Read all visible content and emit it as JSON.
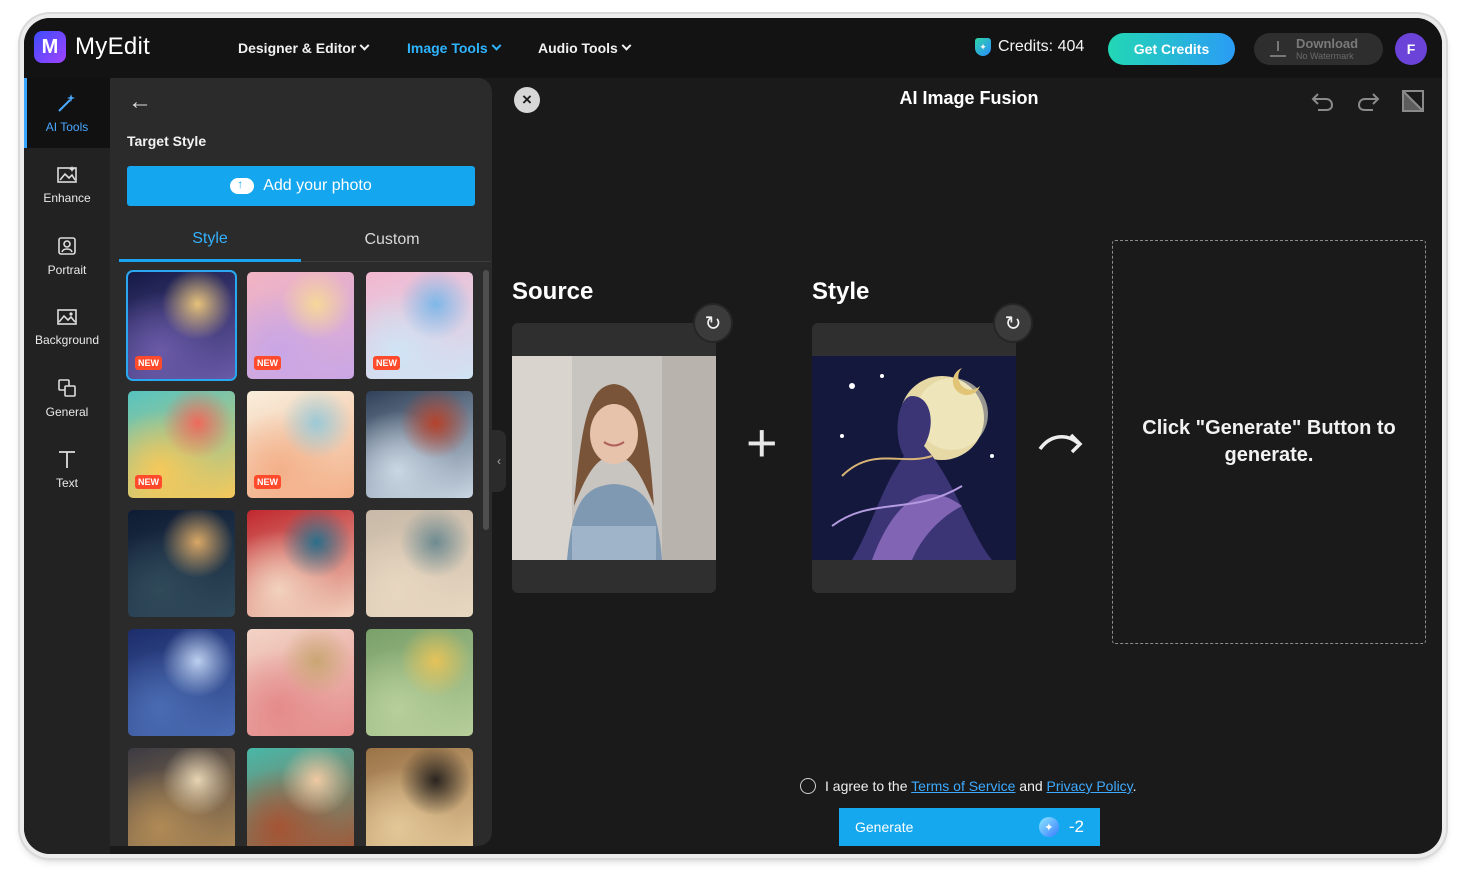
{
  "brand": {
    "name": "MyEdit",
    "logo_letter": "M"
  },
  "nav": [
    {
      "label": "Designer & Editor",
      "active": false
    },
    {
      "label": "Image Tools",
      "active": true
    },
    {
      "label": "Audio Tools",
      "active": false
    }
  ],
  "header": {
    "credits_label": "Credits: 404",
    "get_credits": "Get Credits",
    "download_label": "Download",
    "download_sub": "No Watermark",
    "avatar_letter": "F"
  },
  "rail": [
    {
      "label": "AI Tools",
      "icon": "magic-wand-icon",
      "active": true
    },
    {
      "label": "Enhance",
      "icon": "image-enhance-icon",
      "active": false
    },
    {
      "label": "Portrait",
      "icon": "portrait-icon",
      "active": false
    },
    {
      "label": "Background",
      "icon": "background-icon",
      "active": false
    },
    {
      "label": "General",
      "icon": "general-icon",
      "active": false
    },
    {
      "label": "Text",
      "icon": "text-icon",
      "active": false
    }
  ],
  "panel": {
    "back_icon": "back-arrow-icon",
    "target_style_label": "Target Style",
    "add_photo": "Add your photo",
    "tabs": [
      {
        "label": "Style",
        "active": true
      },
      {
        "label": "Custom",
        "active": false
      }
    ],
    "new_badge": "NEW",
    "styles": [
      {
        "name": "celestial-dancer",
        "is_new": true,
        "selected": true,
        "colors": [
          "#141a45",
          "#6a5aa8",
          "#e6c27a"
        ]
      },
      {
        "name": "pastel-butterflies",
        "is_new": true,
        "selected": false,
        "colors": [
          "#f2b4c2",
          "#c9a6e6",
          "#f6d79a"
        ]
      },
      {
        "name": "dreamy-clouds",
        "is_new": true,
        "selected": false,
        "colors": [
          "#f3b7cf",
          "#cfe4f5",
          "#7fb8e8"
        ]
      },
      {
        "name": "rainbow-hills",
        "is_new": true,
        "selected": false,
        "colors": [
          "#55c3c0",
          "#f6c85a",
          "#ee6a5c"
        ]
      },
      {
        "name": "boho-rainbow-pattern",
        "is_new": true,
        "selected": false,
        "colors": [
          "#f8eedc",
          "#f3b089",
          "#9cc9d6"
        ]
      },
      {
        "name": "snowman-village",
        "is_new": false,
        "selected": false,
        "colors": [
          "#2f4159",
          "#c9d6e3",
          "#b5432c"
        ]
      },
      {
        "name": "winter-night-forest",
        "is_new": false,
        "selected": false,
        "colors": [
          "#0e1b34",
          "#304a5a",
          "#d9a867"
        ]
      },
      {
        "name": "winter-girl-portrait",
        "is_new": false,
        "selected": false,
        "colors": [
          "#c0272d",
          "#f2d2bd",
          "#2b6f8a"
        ]
      },
      {
        "name": "golden-bokeh",
        "is_new": false,
        "selected": false,
        "colors": [
          "#c8b9a8",
          "#e8d7c0",
          "#6e8b91"
        ]
      },
      {
        "name": "starry-snowfall",
        "is_new": false,
        "selected": false,
        "colors": [
          "#1d2d6b",
          "#4a6bb2",
          "#bcd0f0"
        ]
      },
      {
        "name": "art-nouveau-lady",
        "is_new": false,
        "selected": false,
        "colors": [
          "#f2d4c6",
          "#e48b8b",
          "#c9a673"
        ]
      },
      {
        "name": "meadow-child",
        "is_new": false,
        "selected": false,
        "colors": [
          "#7aa06a",
          "#b7cf9a",
          "#e5c35a"
        ]
      },
      {
        "name": "fantasy-architecture",
        "is_new": false,
        "selected": false,
        "colors": [
          "#3b3a42",
          "#b08a55",
          "#e7d4b3"
        ]
      },
      {
        "name": "retro-portrait",
        "is_new": false,
        "selected": false,
        "colors": [
          "#48b8a8",
          "#a55434",
          "#f0c9a3"
        ]
      },
      {
        "name": "egyptian-mural",
        "is_new": false,
        "selected": false,
        "colors": [
          "#9a7246",
          "#e3c797",
          "#2a2520"
        ]
      }
    ]
  },
  "main": {
    "title": "AI Image Fusion",
    "source_label": "Source",
    "style_label": "Style",
    "result_text": "Click \"Generate\" Button to generate.",
    "agree_prefix": "I agree to the",
    "terms": "Terms of Service",
    "agree_and": "and",
    "privacy": "Privacy Policy",
    "agree_suffix": ".",
    "generate": "Generate",
    "cost": "-2"
  },
  "colors": {
    "accent": "#15a8ef",
    "background": "#1a1a1a",
    "panel": "#2b2b2b",
    "new_badge": "#ff4b2b"
  }
}
